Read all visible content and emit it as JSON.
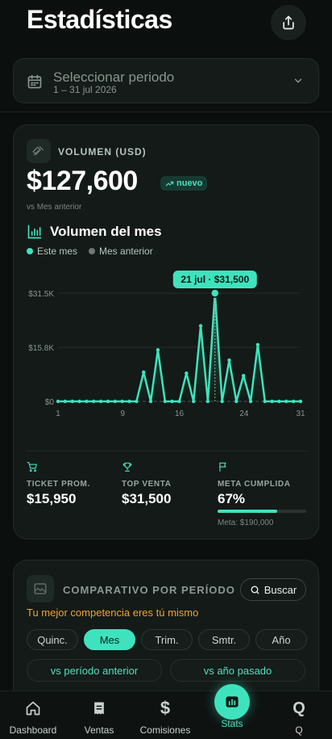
{
  "header": {
    "title": "Estadísticas"
  },
  "period": {
    "title": "Seleccionar periodo",
    "range": "1 – 31 jul 2026"
  },
  "volume": {
    "label": "VOLUMEN (USD)",
    "amount": "$127,600",
    "badge": "nuevo",
    "comparison": "vs Mes anterior"
  },
  "chart_header": {
    "title": "Volumen del mes",
    "legend_current": "Este mes",
    "legend_previous": "Mes anterior"
  },
  "chart_data": {
    "type": "line",
    "x": [
      1,
      2,
      3,
      4,
      5,
      6,
      7,
      8,
      9,
      10,
      11,
      12,
      13,
      14,
      15,
      16,
      17,
      18,
      19,
      20,
      21,
      22,
      23,
      24,
      25,
      26,
      27,
      28,
      29,
      30,
      31
    ],
    "series": [
      {
        "name": "Este mes",
        "values": [
          0,
          0,
          0,
          0,
          0,
          0,
          0,
          0,
          0,
          0,
          0,
          0,
          8500,
          0,
          15000,
          0,
          0,
          0,
          8200,
          0,
          22000,
          0,
          31500,
          0,
          12000,
          0,
          7500,
          0,
          16500,
          0,
          0,
          0,
          0,
          0,
          0
        ]
      },
      {
        "name": "Mes anterior",
        "values": []
      }
    ],
    "x_ticks": [
      "1",
      "9",
      "16",
      "24",
      "31"
    ],
    "y_ticks": [
      "$0",
      "$15.8K",
      "$31.5K"
    ],
    "ylim": [
      0,
      31500
    ],
    "grid": true,
    "tooltip": "21 jul · $31,500",
    "colors": {
      "current": "#3ee3bd",
      "previous": "#6f7874"
    }
  },
  "stats": {
    "ticket_label": "TICKET PROM.",
    "ticket_value": "$15,950",
    "top_label": "TOP VENTA",
    "top_value": "$31,500",
    "meta_label": "META CUMPLIDA",
    "meta_value": "67%",
    "meta_progress": 0.67,
    "meta_target": "Meta: $190,000"
  },
  "compare": {
    "label": "COMPARATIVO POR PERÍODO",
    "search": "Buscar",
    "motto": "Tu mejor competencia eres tú mismo",
    "chips": [
      "Quinc.",
      "Mes",
      "Trim.",
      "Smtr.",
      "Año"
    ],
    "active_chip": "Mes",
    "vs_previous": "vs período anterior",
    "vs_year": "vs año pasado"
  },
  "tabs": {
    "dashboard": "Dashboard",
    "ventas": "Ventas",
    "comisiones": "Comisiones",
    "stats": "Stats",
    "q": "Q"
  },
  "colors": {
    "accent": "#3ee3bd",
    "warning": "#f0a232",
    "background": "#0b0f0e",
    "card": "#131a17"
  }
}
